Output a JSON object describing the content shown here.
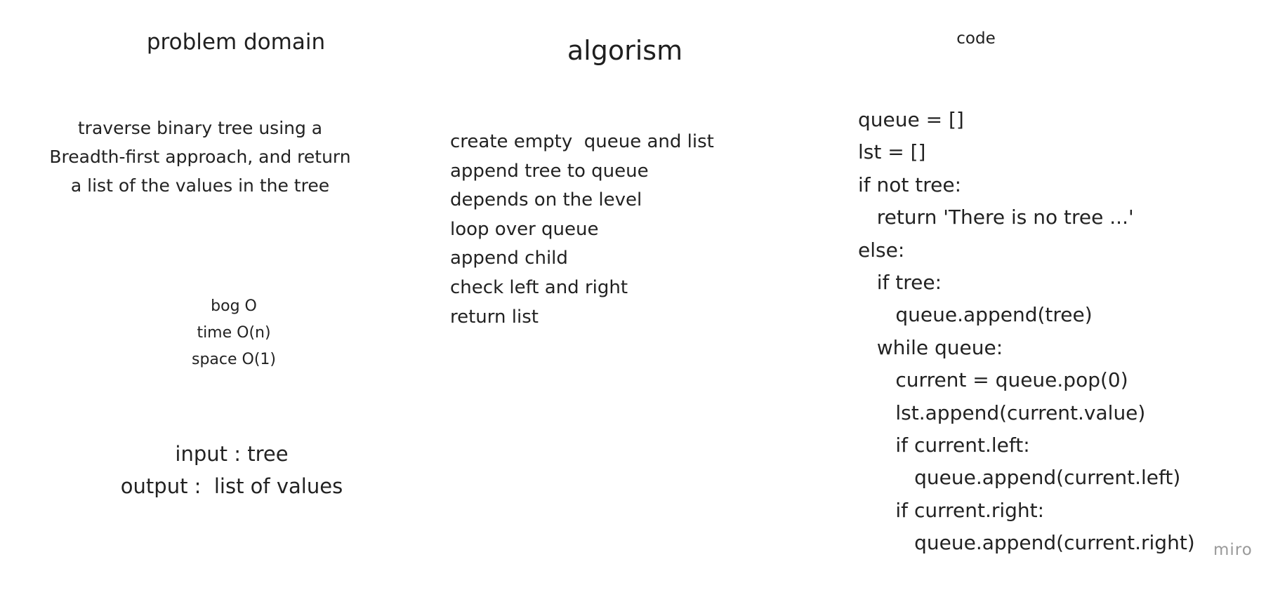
{
  "columns": {
    "problem": {
      "title": "problem domain",
      "description": [
        "traverse binary tree using a",
        "Breadth-first approach, and return",
        "a list of the values in the tree"
      ],
      "big_o": [
        "bog O",
        "time O(n)",
        "space O(1)"
      ],
      "io": [
        "input : tree",
        "output :  list of values"
      ]
    },
    "algorithm": {
      "title": "algorism",
      "steps": [
        "create empty  queue and list",
        "append tree to queue",
        "depends on the level",
        "loop over queue",
        "append child",
        "check left and right",
        "return list"
      ]
    },
    "code": {
      "title": "code",
      "lines": [
        "queue = []",
        "lst = []",
        "if not tree:",
        "   return 'There is no tree ...'",
        "else:",
        "   if tree:",
        "      queue.append(tree)",
        "   while queue:",
        "      current = queue.pop(0)",
        "      lst.append(current.value)",
        "      if current.left:",
        "         queue.append(current.left)",
        "      if current.right:",
        "         queue.append(current.right)"
      ]
    }
  },
  "watermark": "miro"
}
